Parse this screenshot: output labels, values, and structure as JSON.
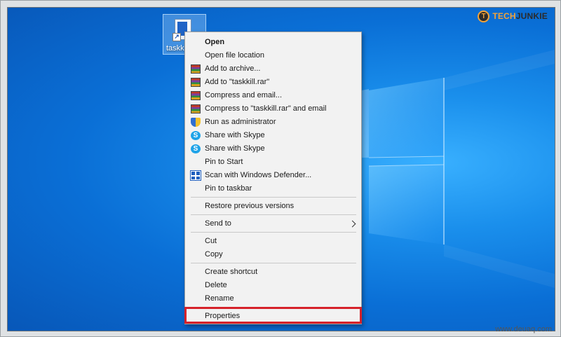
{
  "brand": {
    "letter": "T",
    "part1": "TECH",
    "part2": "JUNKIE"
  },
  "desktop_icon": {
    "label": "taskk"
  },
  "menu": {
    "open": "Open",
    "open_file_location": "Open file location",
    "add_to_archive": "Add to archive...",
    "add_to_rar": "Add to \"taskkill.rar\"",
    "compress_email": "Compress and email...",
    "compress_rar_email": "Compress to \"taskkill.rar\" and email",
    "run_as_admin": "Run as administrator",
    "share_skype_1": "Share with Skype",
    "share_skype_2": "Share with Skype",
    "pin_start": "Pin to Start",
    "scan_defender": "Scan with Windows Defender...",
    "pin_taskbar": "Pin to taskbar",
    "restore_versions": "Restore previous versions",
    "send_to": "Send to",
    "cut": "Cut",
    "copy": "Copy",
    "create_shortcut": "Create shortcut",
    "delete": "Delete",
    "rename": "Rename",
    "properties": "Properties"
  },
  "skype_glyph": "S",
  "shortcut_glyph": "↗",
  "watermark": "www.deuaq.com",
  "colors": {
    "highlight": "#d6222a",
    "desktop_blue": "#0a6fd6",
    "brand_orange": "#f2a33a"
  }
}
